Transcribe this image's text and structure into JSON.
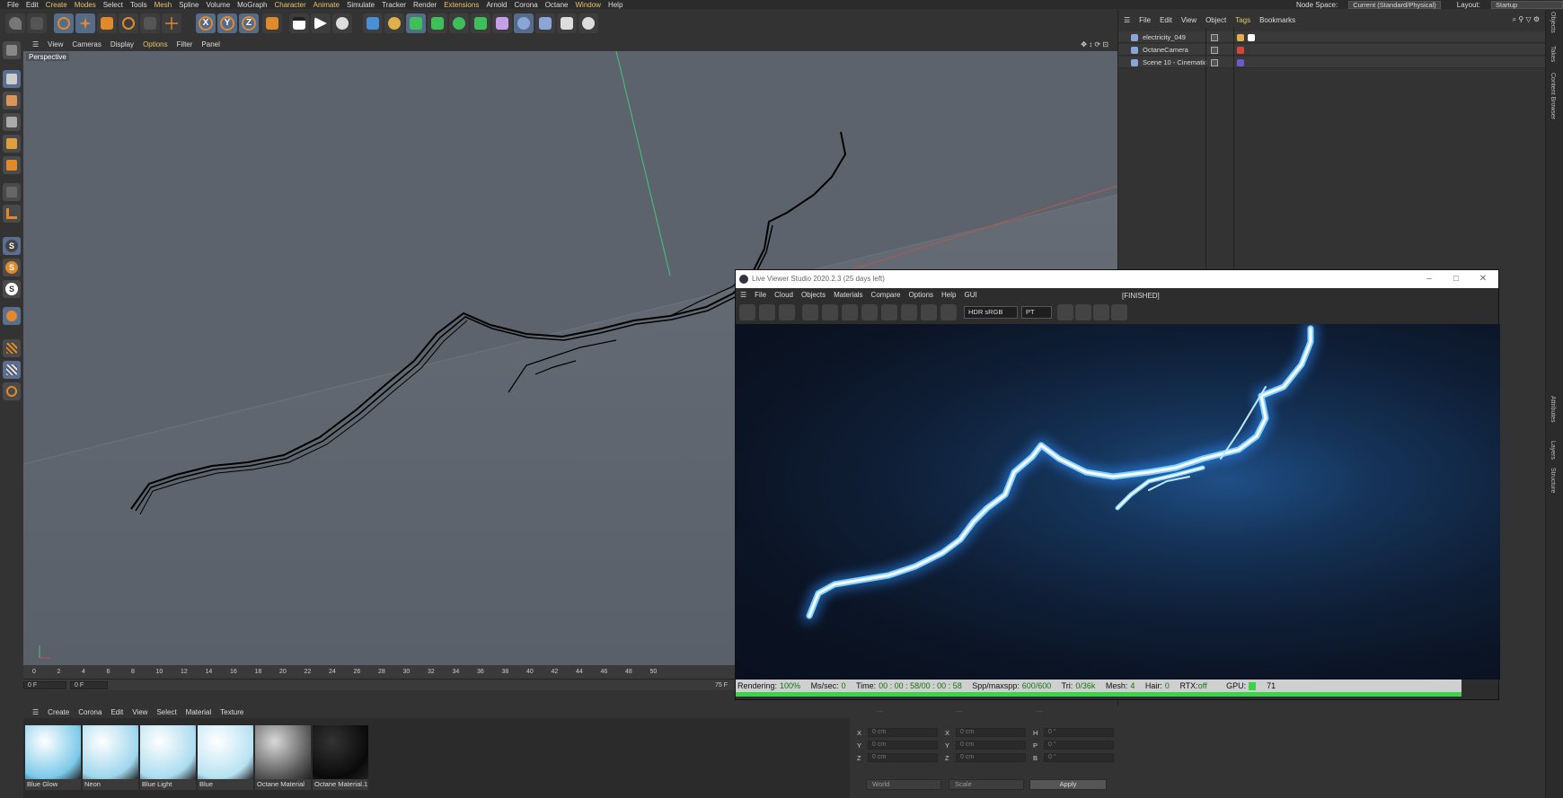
{
  "menubar": {
    "items": [
      "File",
      "Edit",
      "Create",
      "Modes",
      "Select",
      "Tools",
      "Mesh",
      "Spline",
      "Volume",
      "MoGraph",
      "Character",
      "Animate",
      "Simulate",
      "Tracker",
      "Render",
      "Extensions",
      "Arnold",
      "Corona",
      "Octane",
      "Window",
      "Help"
    ],
    "highlighted": [
      "Create",
      "Modes",
      "Mesh",
      "Character",
      "Animate",
      "Extensions",
      "Window"
    ],
    "node_space_label": "Node Space:",
    "node_space_value": "Current (Standard/Physical)",
    "layout_label": "Layout:",
    "layout_value": "Startup"
  },
  "toolbar": {
    "axis_x": "X",
    "axis_y": "Y",
    "axis_z": "Z"
  },
  "lefttools": {
    "s_labels": [
      "S",
      "S",
      "S"
    ]
  },
  "viewport": {
    "menu": [
      "View",
      "Cameras",
      "Display",
      "Options",
      "Filter",
      "Panel"
    ],
    "highlighted": [
      "Options"
    ],
    "label": "Perspective"
  },
  "timeline": {
    "ticks": [
      "0",
      "2",
      "4",
      "6",
      "8",
      "10",
      "12",
      "14",
      "16",
      "18",
      "20",
      "22",
      "24",
      "26",
      "28",
      "30",
      "32",
      "34",
      "36",
      "38",
      "40",
      "42",
      "44",
      "46",
      "48",
      "50"
    ],
    "current_frame": "0 F",
    "start_frame": "0 F",
    "end_frame": "75 F"
  },
  "materials": {
    "menu": [
      "Create",
      "Corona",
      "Edit",
      "View",
      "Select",
      "Material",
      "Texture"
    ],
    "items": [
      {
        "name": "Blue Glow",
        "color_inner": "#ffffff",
        "color_outer": "#7ac9e8"
      },
      {
        "name": "Neon",
        "color_inner": "#ffffff",
        "color_outer": "#9dd6ec"
      },
      {
        "name": "Blue Light",
        "color_inner": "#ffffff",
        "color_outer": "#a9dcf0"
      },
      {
        "name": "Blue",
        "color_inner": "#ffffff",
        "color_outer": "#b7e2f2"
      },
      {
        "name": "Octane Material",
        "color_inner": "#d9d9d9",
        "color_outer": "#555555"
      },
      {
        "name": "Octane Material.1",
        "color_inner": "#333333",
        "color_outer": "#0a0a0a"
      }
    ]
  },
  "coords": {
    "header": [
      "---",
      "---",
      "---"
    ],
    "rows": [
      {
        "a": "X",
        "av": "0 cm",
        "b": "X",
        "bv": "0 cm",
        "c": "H",
        "cv": "0 °"
      },
      {
        "a": "Y",
        "av": "0 cm",
        "b": "Y",
        "bv": "0 cm",
        "c": "P",
        "cv": "0 °"
      },
      {
        "a": "Z",
        "av": "0 cm",
        "b": "Z",
        "bv": "0 cm",
        "c": "B",
        "cv": "0 °"
      }
    ],
    "mode": "World",
    "scale": "Scale",
    "apply": "Apply"
  },
  "objects": {
    "menu": [
      "File",
      "Edit",
      "View",
      "Object",
      "Tags",
      "Bookmarks"
    ],
    "highlighted": [
      "Tags"
    ],
    "rows": [
      "electricity_049",
      "OctaneCamera",
      "Scene 10 - Cinematic"
    ]
  },
  "right_tabs": {
    "top": [
      "Objects",
      "Takes",
      "Content Browser"
    ],
    "bottom": [
      "Attributes",
      "Layers",
      "Structure"
    ]
  },
  "live_viewer": {
    "title": "Live Viewer Studio 2020.2.3 (25 days left)",
    "menu": [
      "File",
      "Cloud",
      "Objects",
      "Materials",
      "Compare",
      "Options",
      "Help",
      "GUI"
    ],
    "status": "[FINISHED]",
    "color_space": "HDR sRGB",
    "kernel": "PT",
    "stats": {
      "rendering_label": "Rendering:",
      "rendering": "100%",
      "ms_label": "Ms/sec:",
      "ms": "0",
      "time_label": "Time:",
      "time": "00 : 00 : 58/00 : 00 : 58",
      "spp_label": "Spp/maxspp:",
      "spp": "600/600",
      "tri_label": "Tri:",
      "tri": "0/36k",
      "mesh_label": "Mesh:",
      "mesh": "4",
      "hair_label": "Hair:",
      "hair": "0",
      "rtx_label": "RTX:",
      "rtx": "off",
      "gpu_label": "GPU:",
      "gpu": "71"
    },
    "progress": 1.0
  },
  "colors": {
    "accent": "#e8c46a",
    "glow": "#4fb6ff",
    "progress": "#3ad34a"
  }
}
